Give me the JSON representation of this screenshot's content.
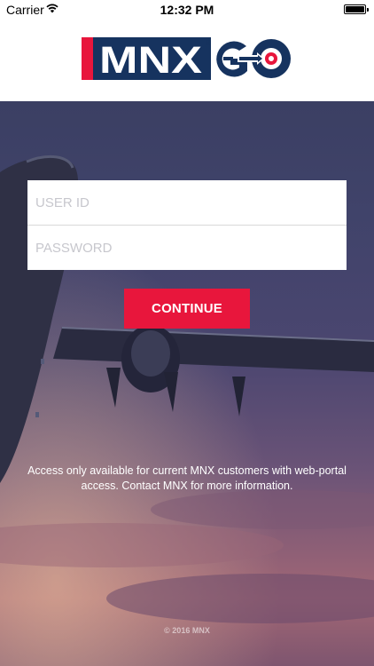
{
  "status_bar": {
    "carrier": "Carrier",
    "time": "12:32 PM"
  },
  "logo": {
    "brand": "MNX",
    "registered": "®",
    "go": "GO"
  },
  "login": {
    "user_id_placeholder": "USER ID",
    "password_placeholder": "PASSWORD",
    "continue_label": "CONTINUE"
  },
  "notice": "Access only available for current MNX customers with web-portal access. Contact MNX for more information.",
  "copyright": "© 2016 MNX",
  "colors": {
    "brand_red": "#e8163c",
    "brand_navy": "#16335f"
  }
}
